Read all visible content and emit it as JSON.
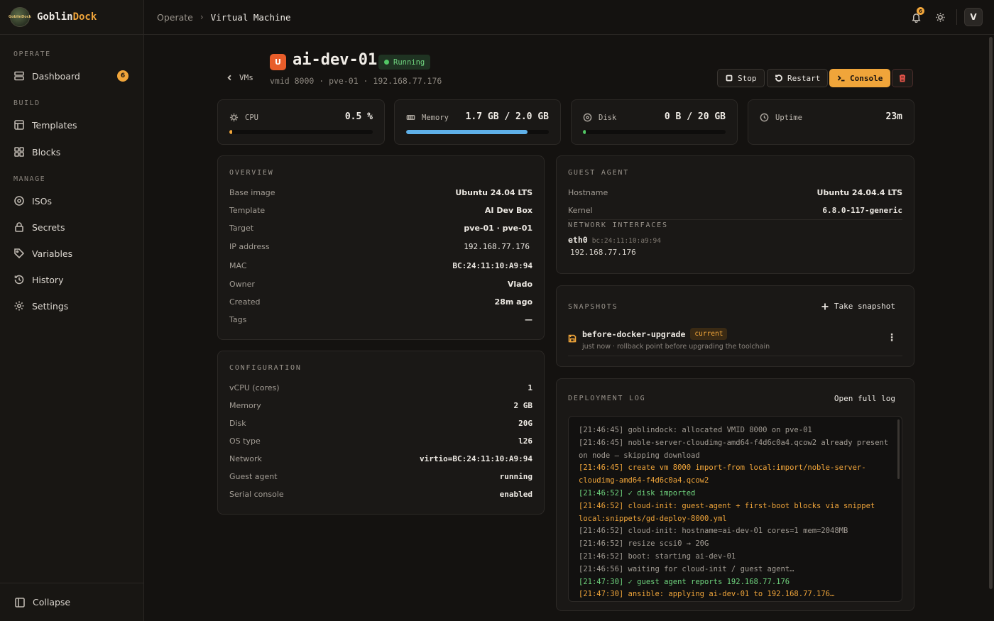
{
  "brand": {
    "name_plain": "Goblin",
    "name_accent": "Dock",
    "logo_text": "GoblinDock"
  },
  "sidebar": {
    "sections": [
      {
        "label": "OPERATE"
      },
      {
        "label": "BUILD"
      },
      {
        "label": "MANAGE"
      }
    ],
    "items": [
      {
        "label": "Dashboard",
        "icon": "server-icon",
        "badge": "6"
      },
      {
        "label": "Templates",
        "icon": "template-icon"
      },
      {
        "label": "Blocks",
        "icon": "grid-icon"
      },
      {
        "label": "ISOs",
        "icon": "disc-icon"
      },
      {
        "label": "Secrets",
        "icon": "lock-icon"
      },
      {
        "label": "Variables",
        "icon": "tag-icon"
      },
      {
        "label": "History",
        "icon": "history-icon"
      },
      {
        "label": "Settings",
        "icon": "gear-icon"
      }
    ],
    "collapse_label": "Collapse"
  },
  "topbar": {
    "breadcrumb": [
      "Operate",
      "Virtual Machine"
    ],
    "notifications_count": "6",
    "avatar_initial": "V"
  },
  "vm": {
    "back_label": "VMs",
    "icon_letter": "U",
    "name": "ai-dev-01",
    "status": "Running",
    "meta": "vmid 8000 · pve-01 · 192.168.77.176",
    "actions": {
      "stop": "Stop",
      "restart": "Restart",
      "console": "Console"
    }
  },
  "metrics": {
    "cpu": {
      "label": "CPU",
      "value": "0.5 %",
      "fraction": 0.02,
      "color": "#f0a53a"
    },
    "memory": {
      "label": "Memory",
      "value": "1.7 GB / 2.0 GB",
      "fraction": 0.85,
      "color": "#5fb0e8"
    },
    "disk": {
      "label": "Disk",
      "value": "0 B / 20 GB",
      "fraction": 0.02,
      "color": "#52c865"
    },
    "uptime": {
      "label": "Uptime",
      "value": "23m"
    }
  },
  "overview": {
    "title": "OVERVIEW",
    "rows": [
      {
        "k": "Base image",
        "v": "Ubuntu 24.04 LTS"
      },
      {
        "k": "Template",
        "v": "AI Dev Box"
      },
      {
        "k": "Target",
        "v": "pve-01 · pve-01"
      },
      {
        "k": "IP address",
        "v": "192.168.77.176"
      },
      {
        "k": "MAC",
        "v": "BC:24:11:10:A9:94"
      },
      {
        "k": "Owner",
        "v": "Vlado"
      },
      {
        "k": "Created",
        "v": "28m ago"
      },
      {
        "k": "Tags",
        "v": "—"
      }
    ]
  },
  "configuration": {
    "title": "CONFIGURATION",
    "rows": [
      {
        "k": "vCPU (cores)",
        "v": "1"
      },
      {
        "k": "Memory",
        "v": "2 GB"
      },
      {
        "k": "Disk",
        "v": "20G"
      },
      {
        "k": "OS type",
        "v": "l26"
      },
      {
        "k": "Network",
        "v": "virtio=BC:24:11:10:A9:94"
      },
      {
        "k": "Guest agent",
        "v": "running"
      },
      {
        "k": "Serial console",
        "v": "enabled"
      }
    ]
  },
  "guest_agent": {
    "title": "GUEST AGENT",
    "rows": [
      {
        "k": "Hostname",
        "v": "Ubuntu 24.04.4 LTS"
      },
      {
        "k": "Kernel",
        "v": "6.8.0-117-generic"
      }
    ],
    "interfaces_title": "NETWORK INTERFACES",
    "iface_name": "eth0",
    "iface_mac": "bc:24:11:10:a9:94",
    "iface_ip": "192.168.77.176"
  },
  "snapshots": {
    "title": "SNAPSHOTS",
    "take_label": "Take snapshot",
    "items": [
      {
        "name": "before-docker-upgrade",
        "badge": "current",
        "desc": "just now · rollback point before upgrading the toolchain"
      }
    ]
  },
  "deployment_log": {
    "title": "DEPLOYMENT LOG",
    "open_label": "Open full log",
    "lines": [
      {
        "text": "[21:46:45] goblindock: allocated VMID 8000 on pve-01",
        "level": "info"
      },
      {
        "text": "[21:46:45] noble-server-cloudimg-amd64-f4d6c0a4.qcow2 already present on node — skipping download",
        "level": "info"
      },
      {
        "text": "[21:46:45] create vm 8000 import-from local:import/noble-server-cloudimg-amd64-f4d6c0a4.qcow2",
        "level": "step"
      },
      {
        "text": "[21:46:52] ✓ disk imported",
        "level": "ok"
      },
      {
        "text": "[21:46:52] cloud-init: guest-agent + first-boot blocks via snippet local:snippets/gd-deploy-8000.yml",
        "level": "step"
      },
      {
        "text": "[21:46:52] cloud-init: hostname=ai-dev-01 cores=1 mem=2048MB",
        "level": "info"
      },
      {
        "text": "[21:46:52] resize scsi0 → 20G",
        "level": "info"
      },
      {
        "text": "[21:46:52] boot: starting ai-dev-01",
        "level": "info"
      },
      {
        "text": "[21:46:56] waiting for cloud-init / guest agent…",
        "level": "info"
      },
      {
        "text": "[21:47:30] ✓ guest agent reports 192.168.77.176",
        "level": "ok"
      },
      {
        "text": "[21:47:30] ansible: applying ai-dev-01 to 192.168.77.176…",
        "level": "step"
      }
    ]
  }
}
